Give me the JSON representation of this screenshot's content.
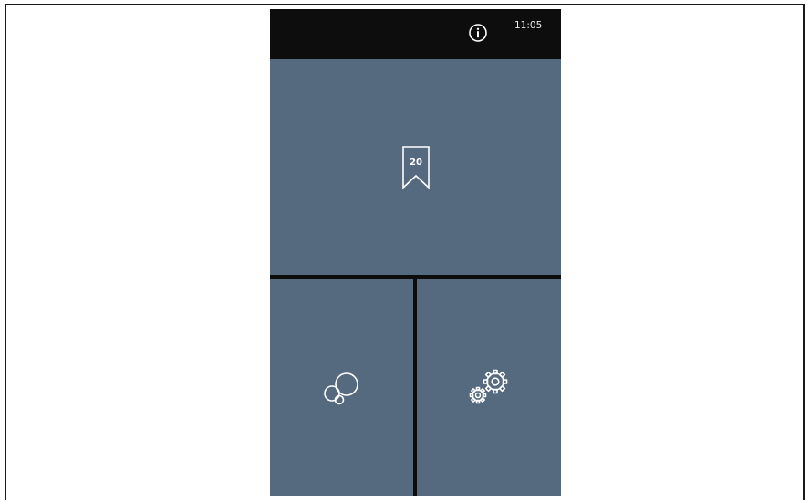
{
  "status_bar": {
    "time": "11:05",
    "info_icon": "info-circle-icon"
  },
  "tiles": {
    "top": {
      "icon": "bookmark-icon",
      "badge_number": "20"
    },
    "bottom_left": {
      "icon": "bubbles-icon"
    },
    "bottom_right": {
      "icon": "gears-icon"
    }
  },
  "colors": {
    "tile_background": "#55697f",
    "status_bar_background": "#0d0d0d",
    "icon_stroke": "#ffffff"
  }
}
